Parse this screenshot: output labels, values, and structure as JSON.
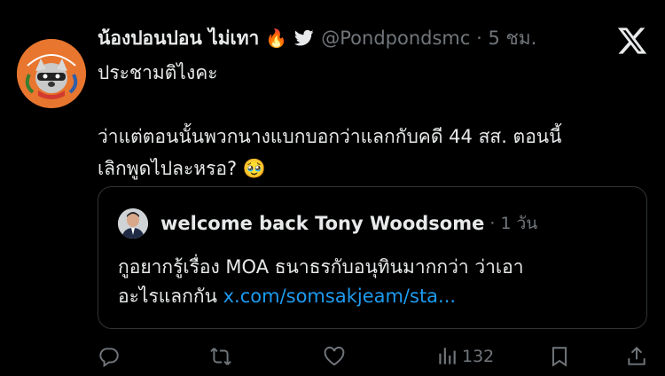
{
  "tweet": {
    "author_name": "น้องปอนปอน ไม่เทา",
    "author_emoji": "🔥",
    "handle_time": "@Pondpondsmc · 5 ชม.",
    "text_line1": "ประชามติไงคะ",
    "text_line2": "ว่าแต่ตอนนั้นพวกนางแบกบอกว่าแลกกับคดี 44 สส. ตอนนี้",
    "text_line3": "เลิกพูดไปละหรอ? 🥹"
  },
  "quote": {
    "author_name": "welcome back Tony Woodsome",
    "time": "· 1 วัน",
    "text_line1": "กูอยากรู้เรื่อง MOA ธนาธรกับอนุทินมากกว่า ว่าเอา",
    "text_line2": "อะไรแลกกัน",
    "link": "x.com/somsakjeam/sta..."
  },
  "actions": {
    "reply_icon": "reply-icon",
    "retweet_icon": "retweet-icon",
    "like_icon": "like-icon",
    "views_icon": "views-icon",
    "views_count": "132",
    "bookmark_icon": "bookmark-icon",
    "share_icon": "share-icon"
  },
  "colors": {
    "background": "#000000",
    "text": "#e7e9ea",
    "muted": "#71767b",
    "link": "#1d9bf0",
    "border": "#2f3336",
    "avatar_orange": "#e8762f"
  }
}
